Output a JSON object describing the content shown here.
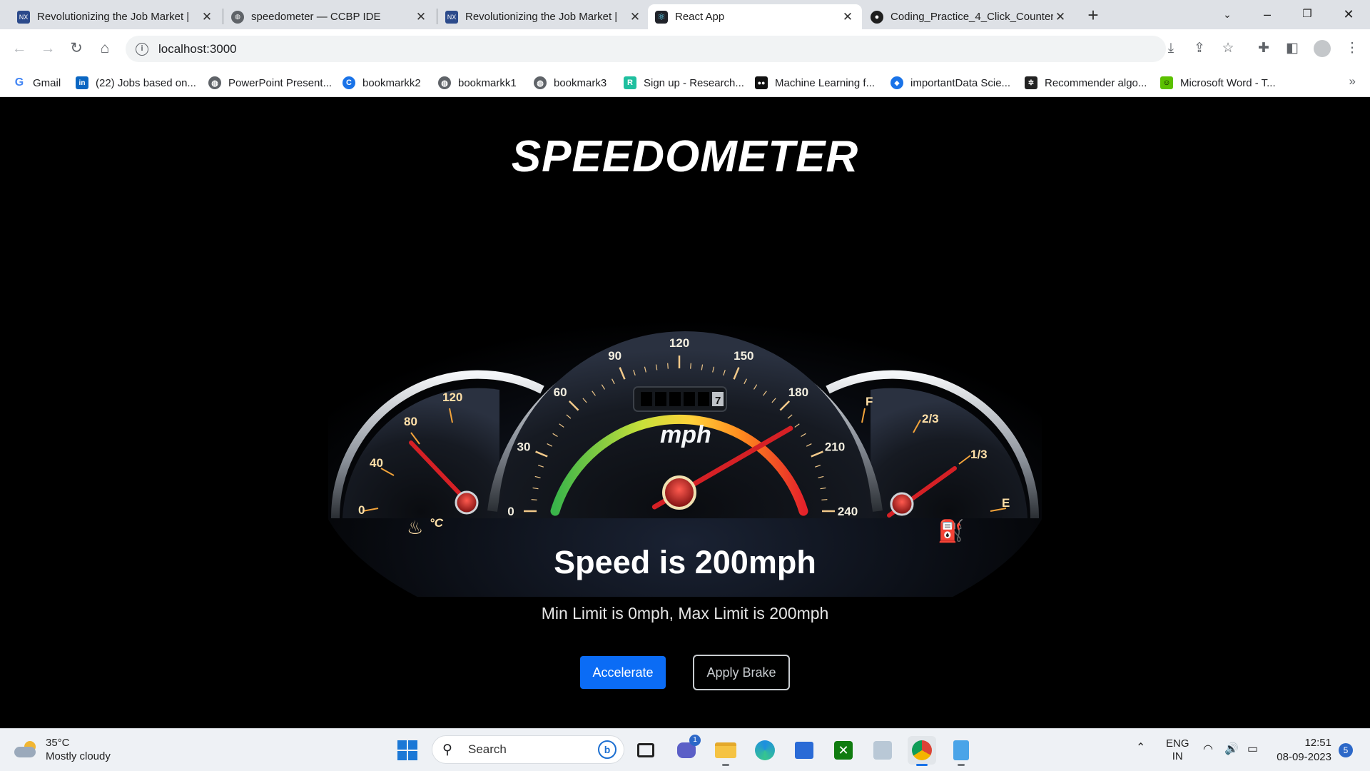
{
  "browser": {
    "tabs": [
      {
        "title": "Revolutionizing the Job Market |",
        "favicon": "nxtwave-icon",
        "active": false
      },
      {
        "title": "speedometer — CCBP IDE",
        "favicon": "globe-icon",
        "active": false
      },
      {
        "title": "Revolutionizing the Job Market |",
        "favicon": "nxtwave-icon",
        "active": false
      },
      {
        "title": "React App",
        "favicon": "react-icon",
        "active": true
      },
      {
        "title": "Coding_Practice_4_Click_Counter",
        "favicon": "github-icon",
        "active": false
      }
    ],
    "url": "localhost:3000",
    "bookmarks": [
      {
        "label": "Gmail",
        "icon": "google-icon",
        "color": "#4285f4"
      },
      {
        "label": "(22) Jobs based on...",
        "icon": "linkedin-icon",
        "color": "#0a66c2"
      },
      {
        "label": "PowerPoint Present...",
        "icon": "globe-icon",
        "color": "#5f6368"
      },
      {
        "label": "bookmarkk2",
        "icon": "c-icon",
        "color": "#1a73e8"
      },
      {
        "label": "bookmarkk1",
        "icon": "globe-icon",
        "color": "#5f6368"
      },
      {
        "label": "bookmark3",
        "icon": "globe-icon",
        "color": "#5f6368"
      },
      {
        "label": "Sign up - Research...",
        "icon": "r-icon",
        "color": "#1fbf9f"
      },
      {
        "label": "Machine Learning f...",
        "icon": "medium-icon",
        "color": "#111111"
      },
      {
        "label": "importantData Scie...",
        "icon": "drop-icon",
        "color": "#1a73e8"
      },
      {
        "label": "Recommender algo...",
        "icon": "gear-box-icon",
        "color": "#222222"
      },
      {
        "label": "Microsoft Word - T...",
        "icon": "smiley-icon",
        "color": "#5cc100"
      }
    ]
  },
  "app": {
    "title": "SPEEDOMETER",
    "speed_text": "Speed is 200mph",
    "limit_text": "Min Limit is 0mph, Max Limit is 200mph",
    "accelerate_label": "Accelerate",
    "brake_label": "Apply Brake",
    "accent_color": "#0b6cf5"
  },
  "gauge": {
    "speed_ticks": [
      "0",
      "30",
      "60",
      "90",
      "120",
      "150",
      "180",
      "210",
      "240"
    ],
    "temp_ticks": [
      "0",
      "40",
      "80",
      "120"
    ],
    "fuel_ticks": [
      "F",
      "2/3",
      "1/3",
      "E"
    ],
    "unit": "mph",
    "temp_unit": "°C",
    "odometer_digit": "7",
    "speed_value": 200,
    "speed_max": 240
  },
  "taskbar": {
    "weather_temp": "35°C",
    "weather_desc": "Mostly cloudy",
    "search_placeholder": "Search",
    "lang_line1": "ENG",
    "lang_line2": "IN",
    "time": "12:51",
    "date": "08-09-2023",
    "notification_count": "5",
    "chat_badge": "1"
  }
}
